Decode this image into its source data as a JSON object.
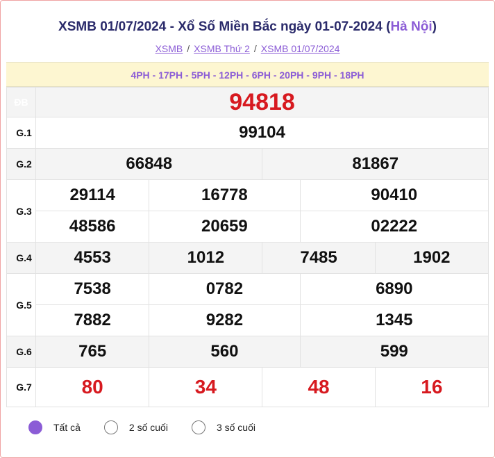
{
  "header": {
    "title_main": "XSMB 01/07/2024 - Xổ Số Miền Bắc ngày 01-07-2024 (",
    "title_region": "Hà Nội",
    "title_close": ")"
  },
  "breadcrumb": [
    "XSMB",
    "XSMB Thứ 2",
    "XSMB 01/07/2024"
  ],
  "breadcrumb_sep": "/",
  "codes": "4PH - 17PH - 5PH - 12PH - 6PH - 20PH - 9PH - 18PH",
  "prizes": {
    "db": {
      "label": "ĐB",
      "values": [
        "94818"
      ]
    },
    "g1": {
      "label": "G.1",
      "values": [
        "99104"
      ]
    },
    "g2": {
      "label": "G.2",
      "values": [
        "66848",
        "81867"
      ]
    },
    "g3": {
      "label": "G.3",
      "values": [
        "29114",
        "16778",
        "90410",
        "48586",
        "20659",
        "02222"
      ]
    },
    "g4": {
      "label": "G.4",
      "values": [
        "4553",
        "1012",
        "7485",
        "1902"
      ]
    },
    "g5": {
      "label": "G.5",
      "values": [
        "7538",
        "0782",
        "6890",
        "7882",
        "9282",
        "1345"
      ]
    },
    "g6": {
      "label": "G.6",
      "values": [
        "765",
        "560",
        "599"
      ]
    },
    "g7": {
      "label": "G.7",
      "values": [
        "80",
        "34",
        "48",
        "16"
      ]
    }
  },
  "filters": [
    {
      "label": "Tất cả",
      "selected": true
    },
    {
      "label": "2 số cuối",
      "selected": false
    },
    {
      "label": "3 số cuối",
      "selected": false
    }
  ],
  "colors": {
    "accent": "#8b5cd6",
    "special_prize": "#d7191f",
    "db_badge": "#f05a5a",
    "code_bar": "#fdf6d1"
  }
}
